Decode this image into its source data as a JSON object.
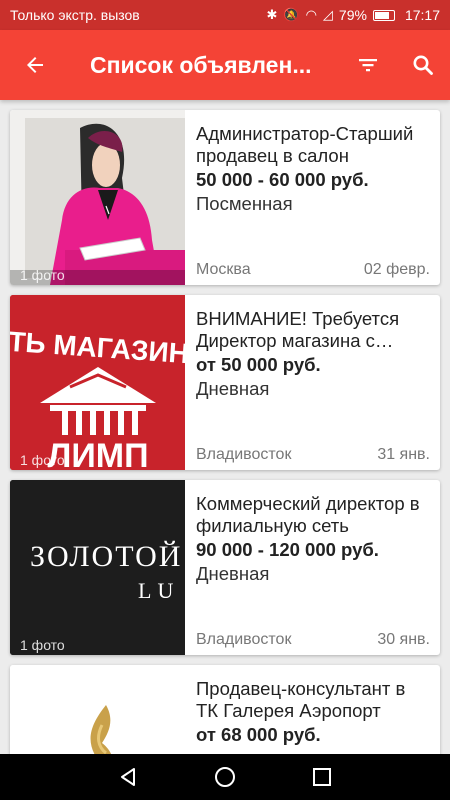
{
  "status_bar": {
    "carrier": "Только экстр. вызов",
    "battery": "79%",
    "time": "17:17"
  },
  "app_bar": {
    "title": "Список объявлен..."
  },
  "listings": [
    {
      "title": "Администратор-Старший продавец в салон",
      "salary": "50 000 - 60 000 руб.",
      "schedule": "Посменная",
      "city": "Москва",
      "date": "02 февр.",
      "photos": "1 фото"
    },
    {
      "title": "ВНИМАНИЕ! Требуется Директор магазина с опытом",
      "salary": "от 50 000 руб.",
      "schedule": "Дневная",
      "city": "Владивосток",
      "date": "31 янв.",
      "photos": "1 фото",
      "logo_text": "ТЬ МАГАЗИН",
      "logo_text2": "ЛИМП"
    },
    {
      "title": "Коммерческий директор в филиальную сеть",
      "salary": "90 000 - 120 000 руб.",
      "schedule": "Дневная",
      "city": "Владивосток",
      "date": "30 янв.",
      "photos": "1 фото",
      "logo_text": "ЗОЛОТОЙ",
      "logo_text2": "LU"
    },
    {
      "title": "Продавец-консультант в ТК Галерея Аэропорт",
      "salary": "от 68 000 руб.",
      "schedule": "",
      "city": "",
      "date": "",
      "photos": ""
    }
  ],
  "colors": {
    "status_bar": "#c9302c",
    "app_bar": "#f44336",
    "accent_pink": "#e91e63"
  }
}
